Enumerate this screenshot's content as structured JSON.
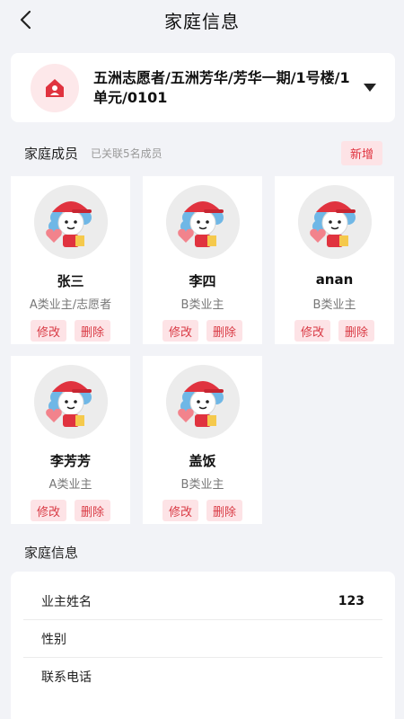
{
  "header": {
    "title": "家庭信息",
    "back_icon": "chevron-left-icon"
  },
  "address": {
    "icon": "home-icon",
    "text": "五洲志愿者/五洲芳华/芳华一期/1号楼/1单元/0101",
    "dropdown_icon": "caret-down-icon"
  },
  "members": {
    "title": "家庭成员",
    "subtitle": "已关联5名成员",
    "add_label": "新增",
    "items": [
      {
        "name": "张三",
        "role": "A类业主/志愿者",
        "edit": "修改",
        "delete": "删除"
      },
      {
        "name": "李四",
        "role": "B类业主",
        "edit": "修改",
        "delete": "删除"
      },
      {
        "name": "anan",
        "role": "B类业主",
        "edit": "修改",
        "delete": "删除"
      },
      {
        "name": "李芳芳",
        "role": "A类业主",
        "edit": "修改",
        "delete": "删除"
      },
      {
        "name": "盖饭",
        "role": "B类业主",
        "edit": "修改",
        "delete": "删除"
      }
    ]
  },
  "family_info": {
    "title": "家庭信息",
    "rows": [
      {
        "label": "业主姓名",
        "value": "123"
      },
      {
        "label": "性别",
        "value": ""
      },
      {
        "label": "联系电话",
        "value": ""
      }
    ]
  },
  "colors": {
    "accent": "#e0333f",
    "accent_bg": "#fde3e6",
    "page_bg": "#f2f3f7"
  }
}
